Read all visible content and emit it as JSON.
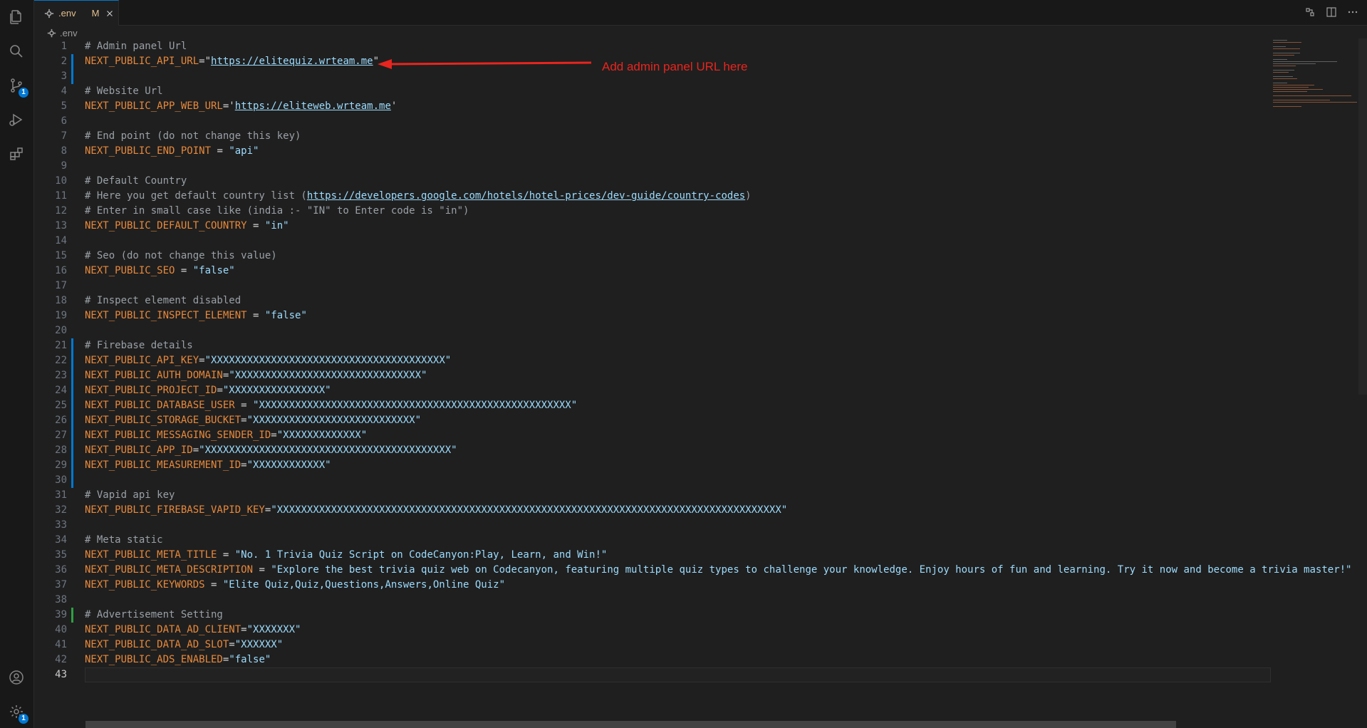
{
  "tab": {
    "filename": ".env",
    "status": "M"
  },
  "breadcrumb": {
    "filename": ".env"
  },
  "activity": {
    "scm_badge": "1",
    "settings_badge": "1"
  },
  "annotation": {
    "text": "Add admin panel URL here"
  },
  "current_line": "43",
  "lines": [
    {
      "n": "1",
      "segs": [
        {
          "t": "# Admin panel Url",
          "c": "cmt"
        }
      ]
    },
    {
      "n": "2",
      "segs": [
        {
          "t": "NEXT_PUBLIC_API_URL",
          "c": "key"
        },
        {
          "t": "=\"",
          "c": "strc"
        },
        {
          "t": "https://elitequiz.wrteam.me",
          "c": "url"
        },
        {
          "t": "\"",
          "c": "strc"
        }
      ]
    },
    {
      "n": "3",
      "segs": []
    },
    {
      "n": "4",
      "segs": [
        {
          "t": "# Website Url",
          "c": "cmt"
        }
      ]
    },
    {
      "n": "5",
      "segs": [
        {
          "t": "NEXT_PUBLIC_APP_WEB_URL",
          "c": "key"
        },
        {
          "t": "='",
          "c": "strc"
        },
        {
          "t": "https://eliteweb.wrteam.me",
          "c": "url"
        },
        {
          "t": "'",
          "c": "strc"
        }
      ]
    },
    {
      "n": "6",
      "segs": []
    },
    {
      "n": "7",
      "segs": [
        {
          "t": "# End point (do not change this key)",
          "c": "cmt"
        }
      ]
    },
    {
      "n": "8",
      "segs": [
        {
          "t": "NEXT_PUBLIC_END_POINT",
          "c": "key"
        },
        {
          "t": " = ",
          "c": "strc"
        },
        {
          "t": "\"api\"",
          "c": "val"
        }
      ]
    },
    {
      "n": "9",
      "segs": []
    },
    {
      "n": "10",
      "segs": [
        {
          "t": "# Default Country",
          "c": "cmt"
        }
      ]
    },
    {
      "n": "11",
      "segs": [
        {
          "t": "# Here you get default country list (",
          "c": "cmt"
        },
        {
          "t": "https://developers.google.com/hotels/hotel-prices/dev-guide/country-codes",
          "c": "url"
        },
        {
          "t": ")",
          "c": "cmt"
        }
      ]
    },
    {
      "n": "12",
      "segs": [
        {
          "t": "# Enter in small case like (india :- \"IN\" to Enter code is \"in\")",
          "c": "cmt"
        }
      ]
    },
    {
      "n": "13",
      "segs": [
        {
          "t": "NEXT_PUBLIC_DEFAULT_COUNTRY",
          "c": "key"
        },
        {
          "t": " = ",
          "c": "strc"
        },
        {
          "t": "\"in\"",
          "c": "val"
        }
      ]
    },
    {
      "n": "14",
      "segs": []
    },
    {
      "n": "15",
      "segs": [
        {
          "t": "# Seo (do not change this value)",
          "c": "cmt"
        }
      ]
    },
    {
      "n": "16",
      "segs": [
        {
          "t": "NEXT_PUBLIC_SEO",
          "c": "key"
        },
        {
          "t": " = ",
          "c": "strc"
        },
        {
          "t": "\"false\"",
          "c": "val"
        }
      ]
    },
    {
      "n": "17",
      "segs": []
    },
    {
      "n": "18",
      "segs": [
        {
          "t": "# Inspect element disabled",
          "c": "cmt"
        }
      ]
    },
    {
      "n": "19",
      "segs": [
        {
          "t": "NEXT_PUBLIC_INSPECT_ELEMENT",
          "c": "key"
        },
        {
          "t": " = ",
          "c": "strc"
        },
        {
          "t": "\"false\"",
          "c": "val"
        }
      ]
    },
    {
      "n": "20",
      "segs": []
    },
    {
      "n": "21",
      "segs": [
        {
          "t": "# Firebase details",
          "c": "cmt"
        }
      ]
    },
    {
      "n": "22",
      "segs": [
        {
          "t": "NEXT_PUBLIC_API_KEY",
          "c": "key"
        },
        {
          "t": "=",
          "c": "strc"
        },
        {
          "t": "\"XXXXXXXXXXXXXXXXXXXXXXXXXXXXXXXXXXXXXXX\"",
          "c": "val"
        }
      ]
    },
    {
      "n": "23",
      "segs": [
        {
          "t": "NEXT_PUBLIC_AUTH_DOMAIN",
          "c": "key"
        },
        {
          "t": "=",
          "c": "strc"
        },
        {
          "t": "\"XXXXXXXXXXXXXXXXXXXXXXXXXXXXXXX\"",
          "c": "val"
        }
      ]
    },
    {
      "n": "24",
      "segs": [
        {
          "t": "NEXT_PUBLIC_PROJECT_ID",
          "c": "key"
        },
        {
          "t": "=",
          "c": "strc"
        },
        {
          "t": "\"XXXXXXXXXXXXXXXX\"",
          "c": "val"
        }
      ]
    },
    {
      "n": "25",
      "segs": [
        {
          "t": "NEXT_PUBLIC_DATABASE_USER",
          "c": "key"
        },
        {
          "t": " = ",
          "c": "strc"
        },
        {
          "t": "\"XXXXXXXXXXXXXXXXXXXXXXXXXXXXXXXXXXXXXXXXXXXXXXXXXXXX\"",
          "c": "val"
        }
      ]
    },
    {
      "n": "26",
      "segs": [
        {
          "t": "NEXT_PUBLIC_STORAGE_BUCKET",
          "c": "key"
        },
        {
          "t": "=",
          "c": "strc"
        },
        {
          "t": "\"XXXXXXXXXXXXXXXXXXXXXXXXXXX\"",
          "c": "val"
        }
      ]
    },
    {
      "n": "27",
      "segs": [
        {
          "t": "NEXT_PUBLIC_MESSAGING_SENDER_ID",
          "c": "key"
        },
        {
          "t": "=",
          "c": "strc"
        },
        {
          "t": "\"XXXXXXXXXXXXX\"",
          "c": "val"
        }
      ]
    },
    {
      "n": "28",
      "segs": [
        {
          "t": "NEXT_PUBLIC_APP_ID",
          "c": "key"
        },
        {
          "t": "=",
          "c": "strc"
        },
        {
          "t": "\"XXXXXXXXXXXXXXXXXXXXXXXXXXXXXXXXXXXXXXXXX\"",
          "c": "val"
        }
      ]
    },
    {
      "n": "29",
      "segs": [
        {
          "t": "NEXT_PUBLIC_MEASUREMENT_ID",
          "c": "key"
        },
        {
          "t": "=",
          "c": "strc"
        },
        {
          "t": "\"XXXXXXXXXXXX\"",
          "c": "val"
        }
      ]
    },
    {
      "n": "30",
      "segs": []
    },
    {
      "n": "31",
      "segs": [
        {
          "t": "# Vapid api key",
          "c": "cmt"
        }
      ]
    },
    {
      "n": "32",
      "segs": [
        {
          "t": "NEXT_PUBLIC_FIREBASE_VAPID_KEY",
          "c": "key"
        },
        {
          "t": "=",
          "c": "strc"
        },
        {
          "t": "\"XXXXXXXXXXXXXXXXXXXXXXXXXXXXXXXXXXXXXXXXXXXXXXXXXXXXXXXXXXXXXXXXXXXXXXXXXXXXXXXXXXXX\"",
          "c": "val"
        }
      ]
    },
    {
      "n": "33",
      "segs": []
    },
    {
      "n": "34",
      "segs": [
        {
          "t": "# Meta static",
          "c": "cmt"
        }
      ]
    },
    {
      "n": "35",
      "segs": [
        {
          "t": "NEXT_PUBLIC_META_TITLE",
          "c": "key"
        },
        {
          "t": " = ",
          "c": "strc"
        },
        {
          "t": "\"No. 1 Trivia Quiz Script on CodeCanyon:Play, Learn, and Win!\"",
          "c": "val"
        }
      ]
    },
    {
      "n": "36",
      "segs": [
        {
          "t": "NEXT_PUBLIC_META_DESCRIPTION",
          "c": "key"
        },
        {
          "t": " = ",
          "c": "strc"
        },
        {
          "t": "\"Explore the best trivia quiz web on Codecanyon, featuring multiple quiz types to challenge your knowledge. Enjoy hours of fun and learning. Try it now and become a trivia master!\"",
          "c": "val"
        }
      ]
    },
    {
      "n": "37",
      "segs": [
        {
          "t": "NEXT_PUBLIC_KEYWORDS",
          "c": "key"
        },
        {
          "t": " = ",
          "c": "strc"
        },
        {
          "t": "\"Elite Quiz,Quiz,Questions,Answers,Online Quiz\"",
          "c": "val"
        }
      ]
    },
    {
      "n": "38",
      "segs": []
    },
    {
      "n": "39",
      "segs": [
        {
          "t": "# Advertisement Setting",
          "c": "cmt"
        }
      ]
    },
    {
      "n": "40",
      "segs": [
        {
          "t": "NEXT_PUBLIC_DATA_AD_CLIENT",
          "c": "key"
        },
        {
          "t": "=",
          "c": "strc"
        },
        {
          "t": "\"XXXXXXX\"",
          "c": "val"
        }
      ]
    },
    {
      "n": "41",
      "segs": [
        {
          "t": "NEXT_PUBLIC_DATA_AD_SLOT",
          "c": "key"
        },
        {
          "t": "=",
          "c": "strc"
        },
        {
          "t": "\"XXXXXX\"",
          "c": "val"
        }
      ]
    },
    {
      "n": "42",
      "segs": [
        {
          "t": "NEXT_PUBLIC_ADS_ENABLED",
          "c": "key"
        },
        {
          "t": "=",
          "c": "strc"
        },
        {
          "t": "\"false\"",
          "c": "val"
        }
      ]
    },
    {
      "n": "43",
      "segs": []
    }
  ]
}
